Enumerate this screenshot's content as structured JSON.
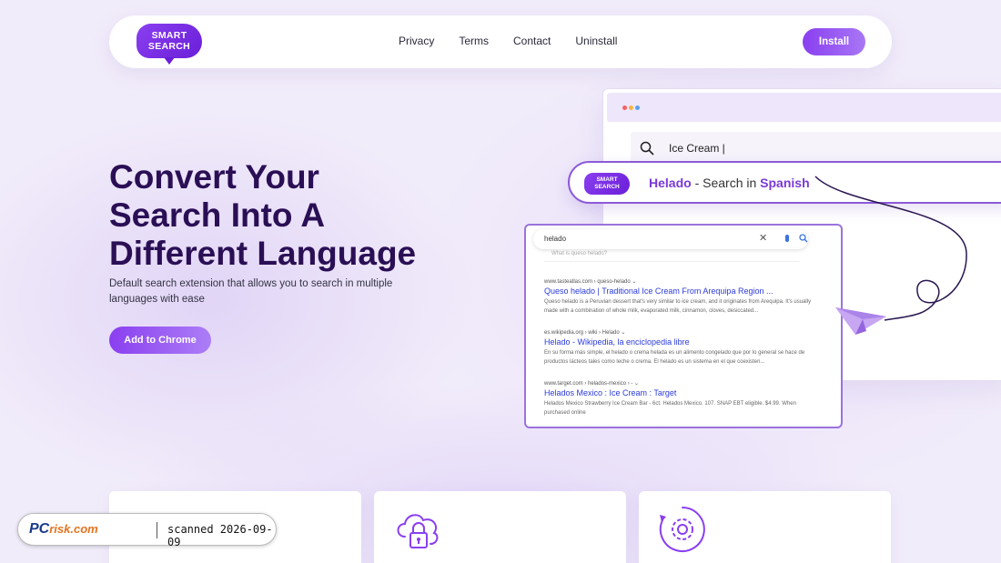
{
  "nav": {
    "logo_line1": "SMART",
    "logo_line2": "SEARCH",
    "links": [
      "Privacy",
      "Terms",
      "Contact",
      "Uninstall"
    ],
    "install_label": "Install"
  },
  "hero": {
    "title_line1": "Convert Your",
    "title_line2": "Search Into A",
    "title_line3": "Different Language",
    "description": "Default search extension that allows you to search in multiple languages with ease",
    "cta_label": "Add to Chrome"
  },
  "browser": {
    "search_query": "Ice Cream |"
  },
  "translate": {
    "logo_line1": "SMART",
    "logo_line2": "SEARCH",
    "term": "Helado",
    "separator": " - Search in ",
    "language": "Spanish"
  },
  "results": {
    "query": "helado",
    "faded_query": "What is queso helado?",
    "items": [
      {
        "url": "www.tasteatlas.com › queso-helado ⌄",
        "title": "Queso helado | Traditional Ice Cream From Arequipa Region ...",
        "snippet": "Queso helado is a Peruvian dessert that's very similar to ice cream, and it originates from Arequipa. It's usually made with a combination of whole milk, evaporated milk, cinnamon, cloves, desiccated..."
      },
      {
        "url": "es.wikipedia.org › wiki › Helado ⌄",
        "title": "Helado - Wikipedia, la enciclopedia libre",
        "snippet": "En su forma más simple, el helado o crema helada es un alimento congelado que por lo general se hace de productos lácteos tales como leche o crema. El helado es un sistema en el que coexisten..."
      },
      {
        "url": "www.target.com › helados-mexico › - ⌄",
        "title": "Helados Mexico : Ice Cream : Target",
        "snippet": "Helados Mexico Strawberry Ice Cream Bar - 6ct. Helados Mexico. 107. SNAP EBT eligible. $4.99. When purchased online"
      }
    ]
  },
  "cards": [
    {
      "icon": "browser-add-icon"
    },
    {
      "icon": "cloud-lock-icon"
    },
    {
      "icon": "gear-sync-icon"
    }
  ],
  "watermark": {
    "brand_pc": "PC",
    "brand_risk": "risk.com",
    "text": "scanned 2026-09-09"
  },
  "colors": {
    "accent": "#8a3ff0",
    "title": "#2a0f55",
    "background": "#f1ecfa"
  }
}
